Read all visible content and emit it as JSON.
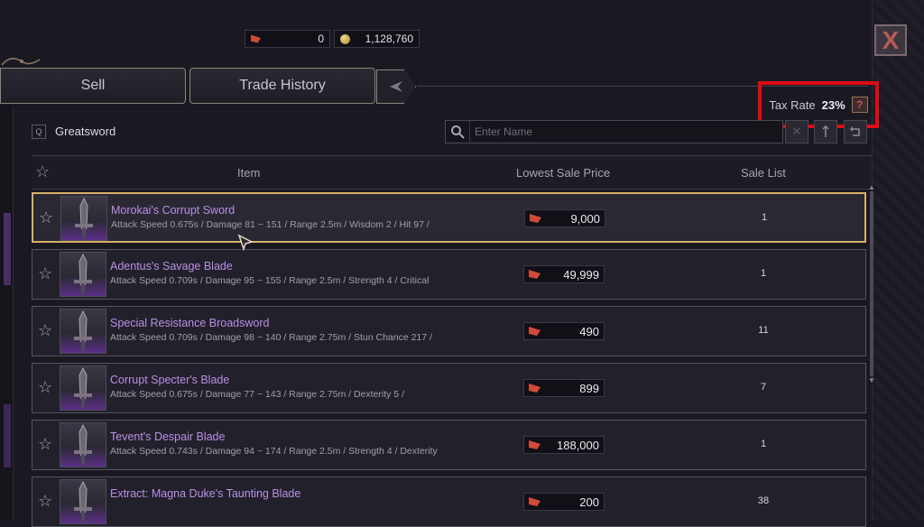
{
  "currency": {
    "red_amount": "0",
    "gold_amount": "1,128,760"
  },
  "close_label": "X",
  "tabs": [
    {
      "label": "Sell"
    },
    {
      "label": "Trade History"
    }
  ],
  "tax": {
    "label": "Tax Rate",
    "value": "23%",
    "help": "?"
  },
  "category": {
    "key_hint": "Q",
    "label": "Greatsword"
  },
  "search": {
    "placeholder": "Enter Name"
  },
  "table": {
    "headers": {
      "item": "Item",
      "price": "Lowest Sale Price",
      "list": "Sale List"
    },
    "rows": [
      {
        "name": "Morokai's Corrupt Sword",
        "stats": "Attack Speed 0.675s / Damage 81 ~ 151 / Range 2.5m / Wisdom 2 / Hit 97 /",
        "price": "9,000",
        "count": "1",
        "selected": true
      },
      {
        "name": "Adentus's Savage Blade",
        "stats": "Attack Speed 0.709s / Damage 95 ~ 155 / Range 2.5m / Strength 4 / Critical",
        "price": "49,999",
        "count": "1"
      },
      {
        "name": "Special Resistance Broadsword",
        "stats": "Attack Speed 0.709s / Damage 98 ~ 140 / Range 2.75m / Stun Chance 217 /",
        "price": "490",
        "count": "11"
      },
      {
        "name": "Corrupt Specter's Blade",
        "stats": "Attack Speed 0.675s / Damage 77 ~ 143 / Range 2.75m / Dexterity 5 /",
        "price": "899",
        "count": "7"
      },
      {
        "name": "Tevent's Despair Blade",
        "stats": "Attack Speed 0.743s / Damage 94 ~ 174 / Range 2.5m / Strength 4 / Dexterity",
        "price": "188,000",
        "count": "1"
      },
      {
        "name": "Extract: Magna Duke's Taunting Blade",
        "stats": "",
        "price": "200",
        "count": "38"
      }
    ]
  },
  "colors": {
    "highlight": "#e00b14",
    "item_name": "#b98fe6",
    "selected_border": "#d8b06a"
  }
}
